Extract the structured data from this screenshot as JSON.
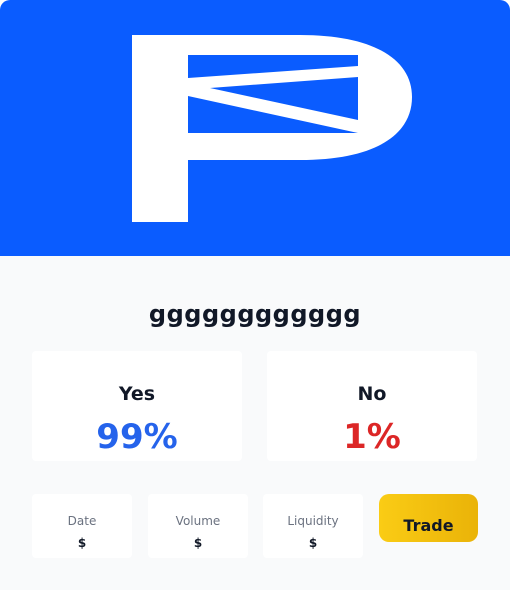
{
  "banner": {
    "background_color": "#0a5cff",
    "logo": "P-logo"
  },
  "market": {
    "title": "gggggggggggg"
  },
  "outcomes": {
    "yes": {
      "label": "Yes",
      "percent": "99%",
      "color": "#2563eb"
    },
    "no": {
      "label": "No",
      "percent": "1%",
      "color": "#dc2626"
    }
  },
  "stats": [
    {
      "label": "Date",
      "value": "$"
    },
    {
      "label": "Volume",
      "value": "$"
    },
    {
      "label": "Liquidity",
      "value": "$"
    }
  ],
  "actions": {
    "trade_label": "Trade",
    "trade_color": "#facc15"
  }
}
